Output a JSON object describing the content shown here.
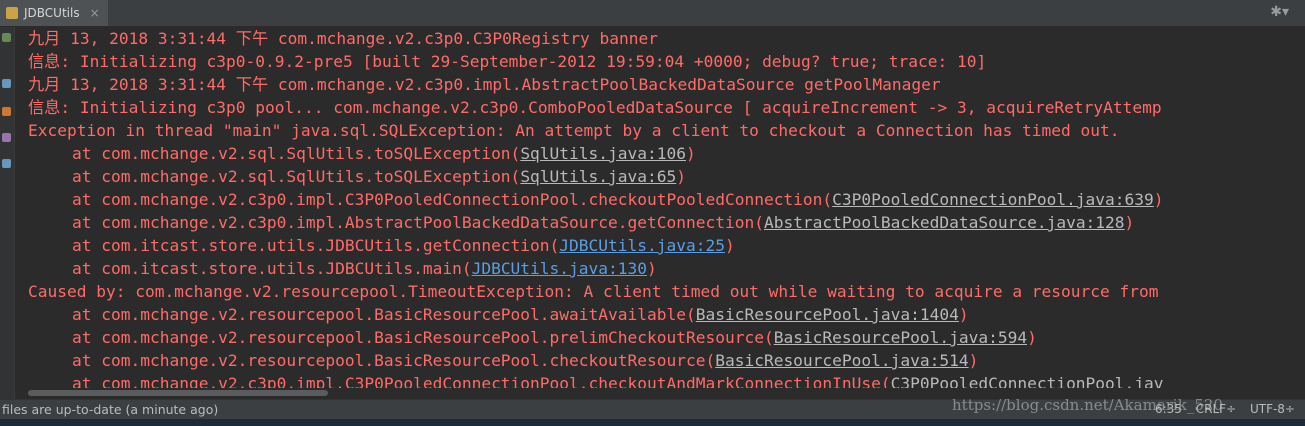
{
  "tab": {
    "label": "JDBCUtils",
    "close": "×"
  },
  "toolbar": {
    "gear": "✱▾"
  },
  "console": {
    "lines": [
      {
        "segments": [
          {
            "text": "九月 13, 2018 3:31:44 下午 com.mchange.v2.c3p0.C3P0Registry banner"
          }
        ]
      },
      {
        "segments": [
          {
            "text": "信息: Initializing c3p0-0.9.2-pre5 [built 29-September-2012 19:59:04 +0000; debug? true; trace: 10]"
          }
        ]
      },
      {
        "segments": [
          {
            "text": "九月 13, 2018 3:31:44 下午 com.mchange.v2.c3p0.impl.AbstractPoolBackedDataSource getPoolManager"
          }
        ]
      },
      {
        "segments": [
          {
            "text": "信息: Initializing c3p0 pool... com.mchange.v2.c3p0.ComboPooledDataSource [ acquireIncrement -> 3, acquireRetryAttemp"
          }
        ]
      },
      {
        "segments": [
          {
            "text": "Exception in thread \"main\" java.sql.SQLException: An attempt by a client to checkout a Connection has timed out."
          }
        ]
      },
      {
        "indent": true,
        "segments": [
          {
            "text": "at com.mchange.v2.sql.SqlUtils.toSQLException("
          },
          {
            "text": "SqlUtils.java:106",
            "link": "gray"
          },
          {
            "text": ")"
          }
        ]
      },
      {
        "indent": true,
        "segments": [
          {
            "text": "at com.mchange.v2.sql.SqlUtils.toSQLException("
          },
          {
            "text": "SqlUtils.java:65",
            "link": "gray"
          },
          {
            "text": ")"
          }
        ]
      },
      {
        "indent": true,
        "segments": [
          {
            "text": "at com.mchange.v2.c3p0.impl.C3P0PooledConnectionPool.checkoutPooledConnection("
          },
          {
            "text": "C3P0PooledConnectionPool.java:639",
            "link": "gray"
          },
          {
            "text": ")"
          }
        ]
      },
      {
        "indent": true,
        "segments": [
          {
            "text": "at com.mchange.v2.c3p0.impl.AbstractPoolBackedDataSource.getConnection("
          },
          {
            "text": "AbstractPoolBackedDataSource.java:128",
            "link": "gray"
          },
          {
            "text": ")"
          }
        ]
      },
      {
        "indent": true,
        "segments": [
          {
            "text": "at com.itcast.store.utils.JDBCUtils.getConnection("
          },
          {
            "text": "JDBCUtils.java:25",
            "link": "blue"
          },
          {
            "text": ")"
          }
        ]
      },
      {
        "indent": true,
        "segments": [
          {
            "text": "at com.itcast.store.utils.JDBCUtils.main("
          },
          {
            "text": "JDBCUtils.java:130",
            "link": "blue"
          },
          {
            "text": ")"
          }
        ]
      },
      {
        "segments": [
          {
            "text": "Caused by: com.mchange.v2.resourcepool.TimeoutException: A client timed out while waiting to acquire a resource from"
          }
        ]
      },
      {
        "indent": true,
        "segments": [
          {
            "text": "at com.mchange.v2.resourcepool.BasicResourcePool.awaitAvailable("
          },
          {
            "text": "BasicResourcePool.java:1404",
            "link": "gray"
          },
          {
            "text": ")"
          }
        ]
      },
      {
        "indent": true,
        "segments": [
          {
            "text": "at com.mchange.v2.resourcepool.BasicResourcePool.prelimCheckoutResource("
          },
          {
            "text": "BasicResourcePool.java:594",
            "link": "gray"
          },
          {
            "text": ")"
          }
        ]
      },
      {
        "indent": true,
        "segments": [
          {
            "text": "at com.mchange.v2.resourcepool.BasicResourcePool.checkoutResource("
          },
          {
            "text": "BasicResourcePool.java:514",
            "link": "gray"
          },
          {
            "text": ")"
          }
        ]
      },
      {
        "indent": true,
        "segments": [
          {
            "text": "at com.mchange.v2.c3p0.impl.C3P0PooledConnectionPool.checkoutAndMarkConnectionInUse("
          },
          {
            "text": "C3P0PooledConnectionPool.jav",
            "link": "gray"
          }
        ]
      }
    ]
  },
  "status": {
    "message": "files are up-to-date (a minute ago)",
    "position": "6:35",
    "line_sep": "CRLF÷",
    "encoding": "UTF-8÷"
  },
  "watermark": "https://blog.csdn.net/Akamarik_520",
  "colors": {
    "error": "#ff6b68",
    "link_blue": "#5a9ee6",
    "link_gray": "#b9b9b9",
    "background": "#2b2b2b"
  }
}
